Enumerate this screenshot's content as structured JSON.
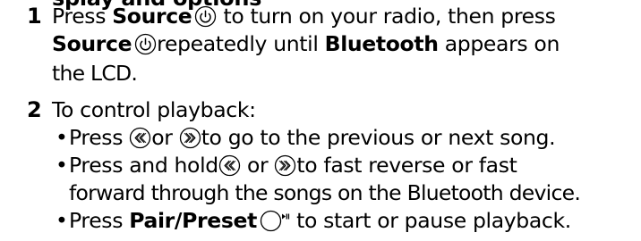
{
  "heading_fragment": "splay and options",
  "steps": [
    {
      "number": "1",
      "lines": [
        {
          "pre": "Press ",
          "bold1": "Source",
          "post1": " to turn on your radio, then press"
        },
        {
          "bold1": "Source",
          "post1": "repeatedly until ",
          "bold2": "Bluetooth",
          "post2": " appears on"
        },
        {
          "text": "the LCD."
        }
      ]
    },
    {
      "number": "2",
      "intro": "To control playback:",
      "bullets": [
        {
          "pre": "Press ",
          "mid": "or ",
          "post": "to go to the previous or next song."
        },
        {
          "pre": "Press and hold",
          "mid": " or ",
          "post": "to fast reverse or fast",
          "continuation": "forward through the songs on the Bluetooth device."
        },
        {
          "pre": "Press ",
          "bold": "Pair/Preset",
          "post": " to start or pause playback."
        }
      ]
    }
  ],
  "icons": {
    "power": "power-icon",
    "previous": "previous-double-chevron-icon",
    "next": "next-double-chevron-icon",
    "pair": "pair-preset-button-icon"
  },
  "bullet_char": "•"
}
